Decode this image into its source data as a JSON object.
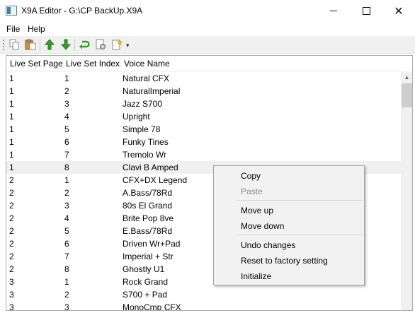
{
  "window": {
    "title": "X9A Editor - G:\\CP BackUp.X9A",
    "minimize_icon": "minimize-icon",
    "maximize_icon": "maximize-icon",
    "close_glyph": "✕"
  },
  "menu": {
    "file": "File",
    "help": "Help"
  },
  "toolbar": {
    "icons": [
      "copy-icon",
      "paste-icon",
      "move-up-icon",
      "move-down-icon",
      "undo-icon",
      "reset-factory-icon",
      "initialize-icon"
    ],
    "overflow_glyph": "▾",
    "colors": {
      "arrow_green": "#3c9a2e",
      "paste_brown": "#c8903a"
    }
  },
  "table": {
    "columns": [
      "Live Set Page",
      "Live Set Index",
      "Voice Name"
    ],
    "rows": [
      [
        "1",
        "1",
        "Natural CFX"
      ],
      [
        "1",
        "2",
        "NaturalImperial"
      ],
      [
        "1",
        "3",
        "Jazz S700"
      ],
      [
        "1",
        "4",
        "Upright"
      ],
      [
        "1",
        "5",
        "Simple 78"
      ],
      [
        "1",
        "6",
        "Funky Tines"
      ],
      [
        "1",
        "7",
        "Tremolo Wr"
      ],
      [
        "1",
        "8",
        "Clavi B Amped"
      ],
      [
        "2",
        "1",
        "CFX+DX Legend"
      ],
      [
        "2",
        "2",
        "A.Bass/78Rd"
      ],
      [
        "2",
        "3",
        "80s El Grand"
      ],
      [
        "2",
        "4",
        "Brite Pop 8ve"
      ],
      [
        "2",
        "5",
        "E.Bass/78Rd"
      ],
      [
        "2",
        "6",
        "Driven Wr+Pad"
      ],
      [
        "2",
        "7",
        "Imperial + Str"
      ],
      [
        "2",
        "8",
        "Ghostly U1"
      ],
      [
        "3",
        "1",
        "Rock Grand"
      ],
      [
        "3",
        "2",
        "S700 + Pad"
      ],
      [
        "3",
        "3",
        "MonoCmp CFX"
      ]
    ],
    "selected_row_index": 7
  },
  "context_menu": {
    "copy": "Copy",
    "paste": "Paste",
    "move_up": "Move up",
    "move_down": "Move down",
    "undo": "Undo changes",
    "reset": "Reset to factory setting",
    "initialize": "Initialize"
  },
  "scrollbar": {
    "up_glyph": "▲"
  }
}
